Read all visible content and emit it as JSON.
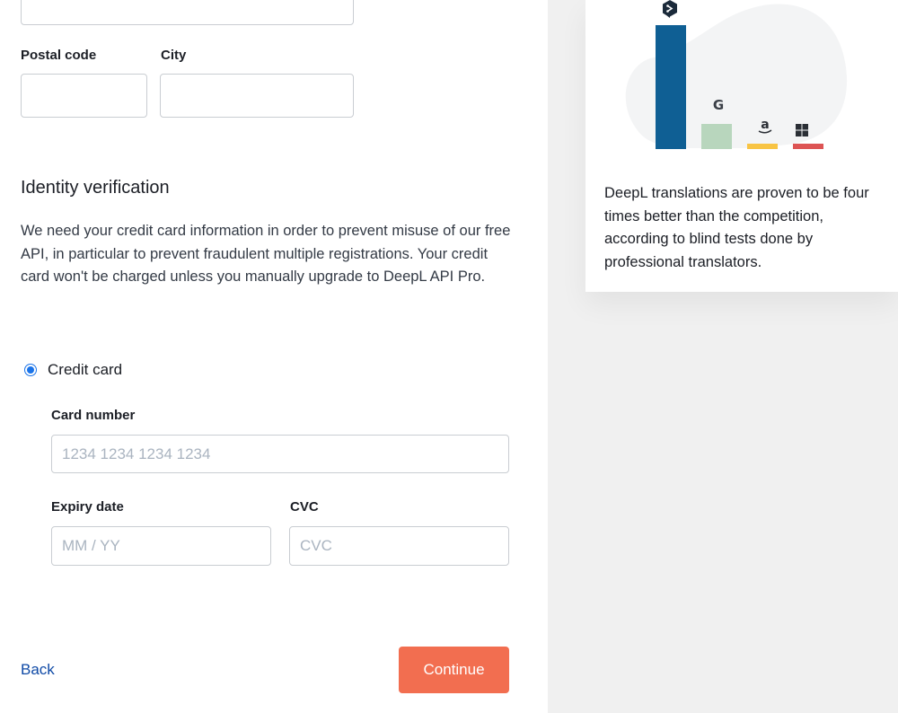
{
  "address": {
    "postal_code_label": "Postal code",
    "city_label": "City"
  },
  "identity": {
    "title": "Identity verification",
    "description": "We need your credit card information in order to prevent misuse of our free API, in particular to prevent fraudulent multiple registrations. Your credit card won't be charged unless you manually upgrade to DeepL API Pro."
  },
  "payment": {
    "option_label": "Credit card",
    "card_number_label": "Card number",
    "card_number_placeholder": "1234 1234 1234 1234",
    "expiry_label": "Expiry date",
    "expiry_placeholder": "MM / YY",
    "cvc_label": "CVC",
    "cvc_placeholder": "CVC"
  },
  "actions": {
    "back_label": "Back",
    "continue_label": "Continue"
  },
  "promo": {
    "text": "DeepL translations are proven to be four times better than the competition, according to blind tests done by professional translators.",
    "brand_icons": [
      "deepl-icon",
      "google-icon",
      "amazon-icon",
      "microsoft-icon"
    ],
    "colors": {
      "deepl": "#0f5f94",
      "google": "#b8d6bd",
      "amazon": "#f8c444",
      "microsoft": "#dd5454"
    }
  },
  "colors": {
    "continue_button": "#f26e50",
    "link": "#0f4aa6",
    "radio_accent": "#1a73e8",
    "side_panel_bg": "#f0f0f0"
  }
}
